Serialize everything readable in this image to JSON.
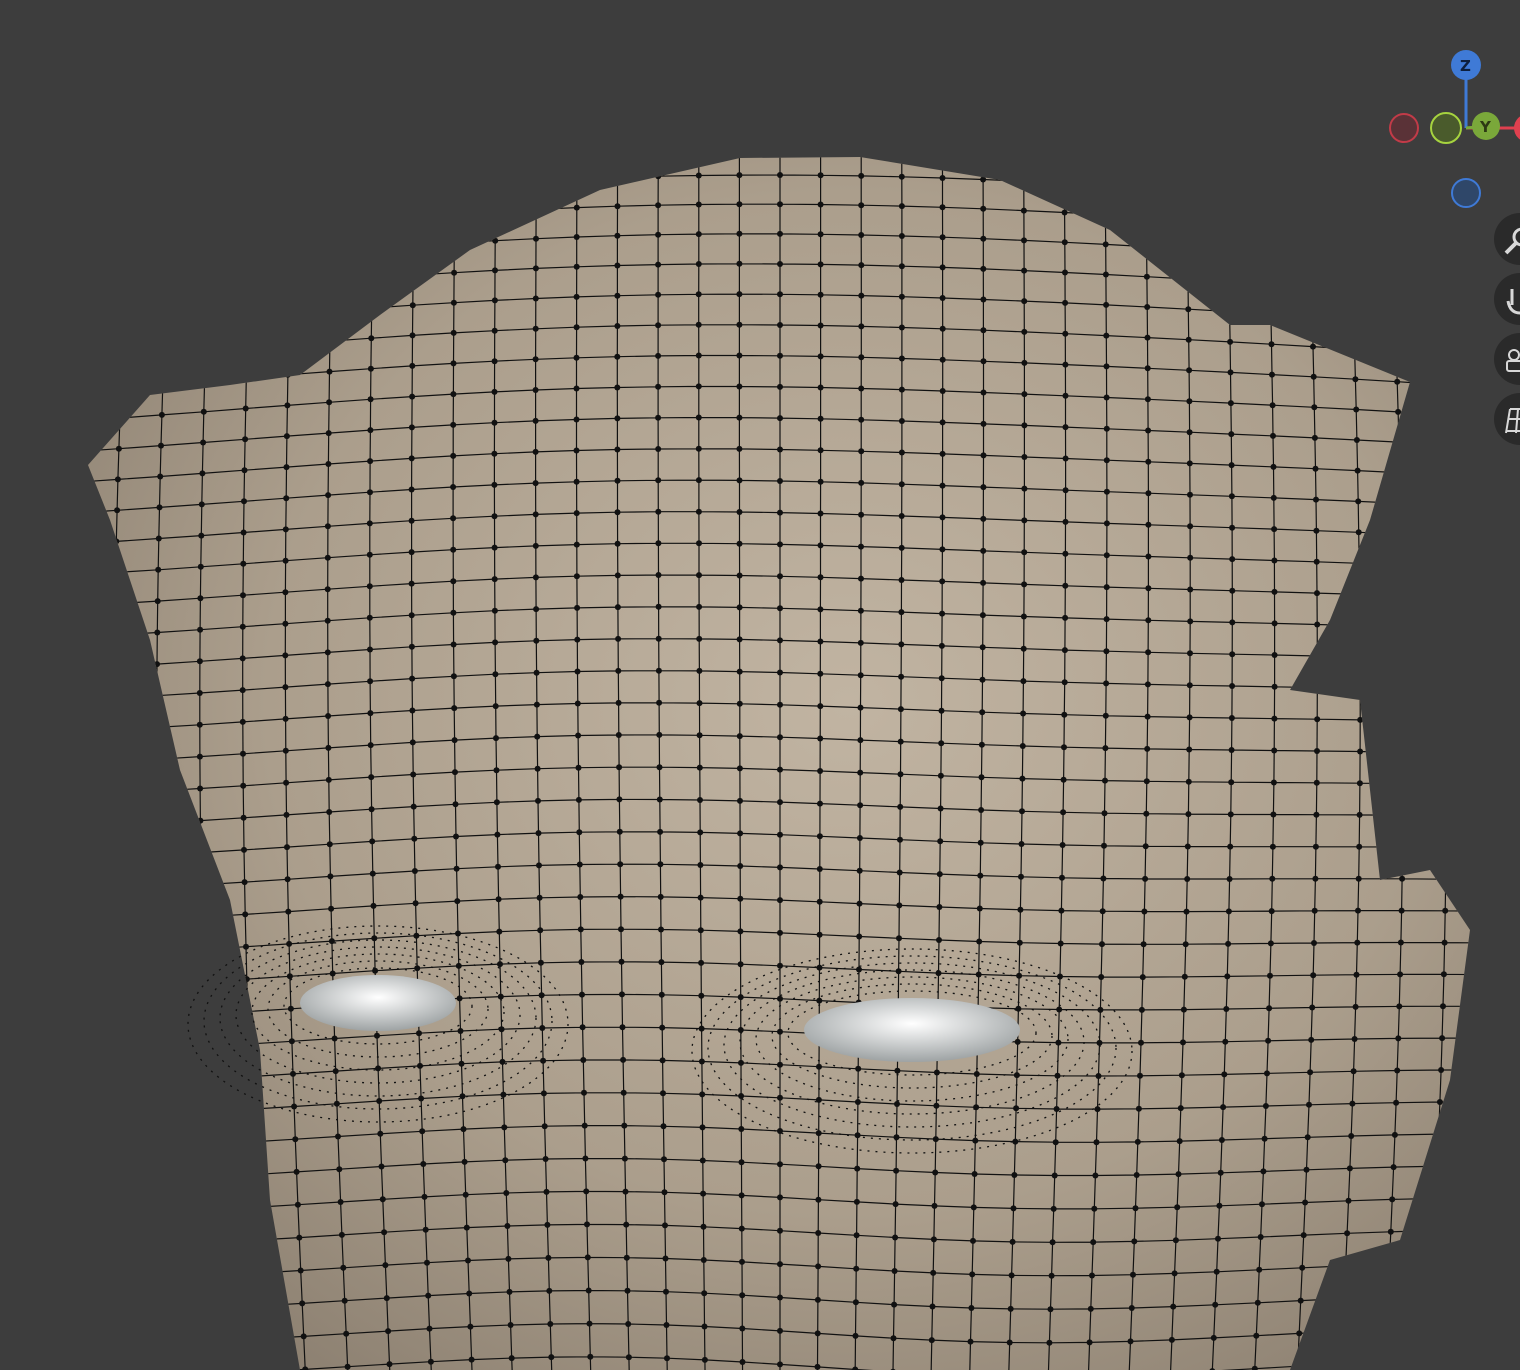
{
  "viewport": {
    "background": "#3d3d3d",
    "mesh_color": "#b4a796",
    "wire_color": "#111111",
    "eye_color": "#e6e8e8"
  },
  "gizmo": {
    "z_label": "Z",
    "y_label": "Y",
    "x_color": "#e0404f",
    "y_color": "#7aa83a",
    "z_color": "#3f7ad6"
  },
  "nav_buttons": [
    {
      "icon": "zoom-icon"
    },
    {
      "icon": "pan-hand-icon"
    },
    {
      "icon": "camera-icon"
    },
    {
      "icon": "grid-perspective-icon"
    }
  ]
}
